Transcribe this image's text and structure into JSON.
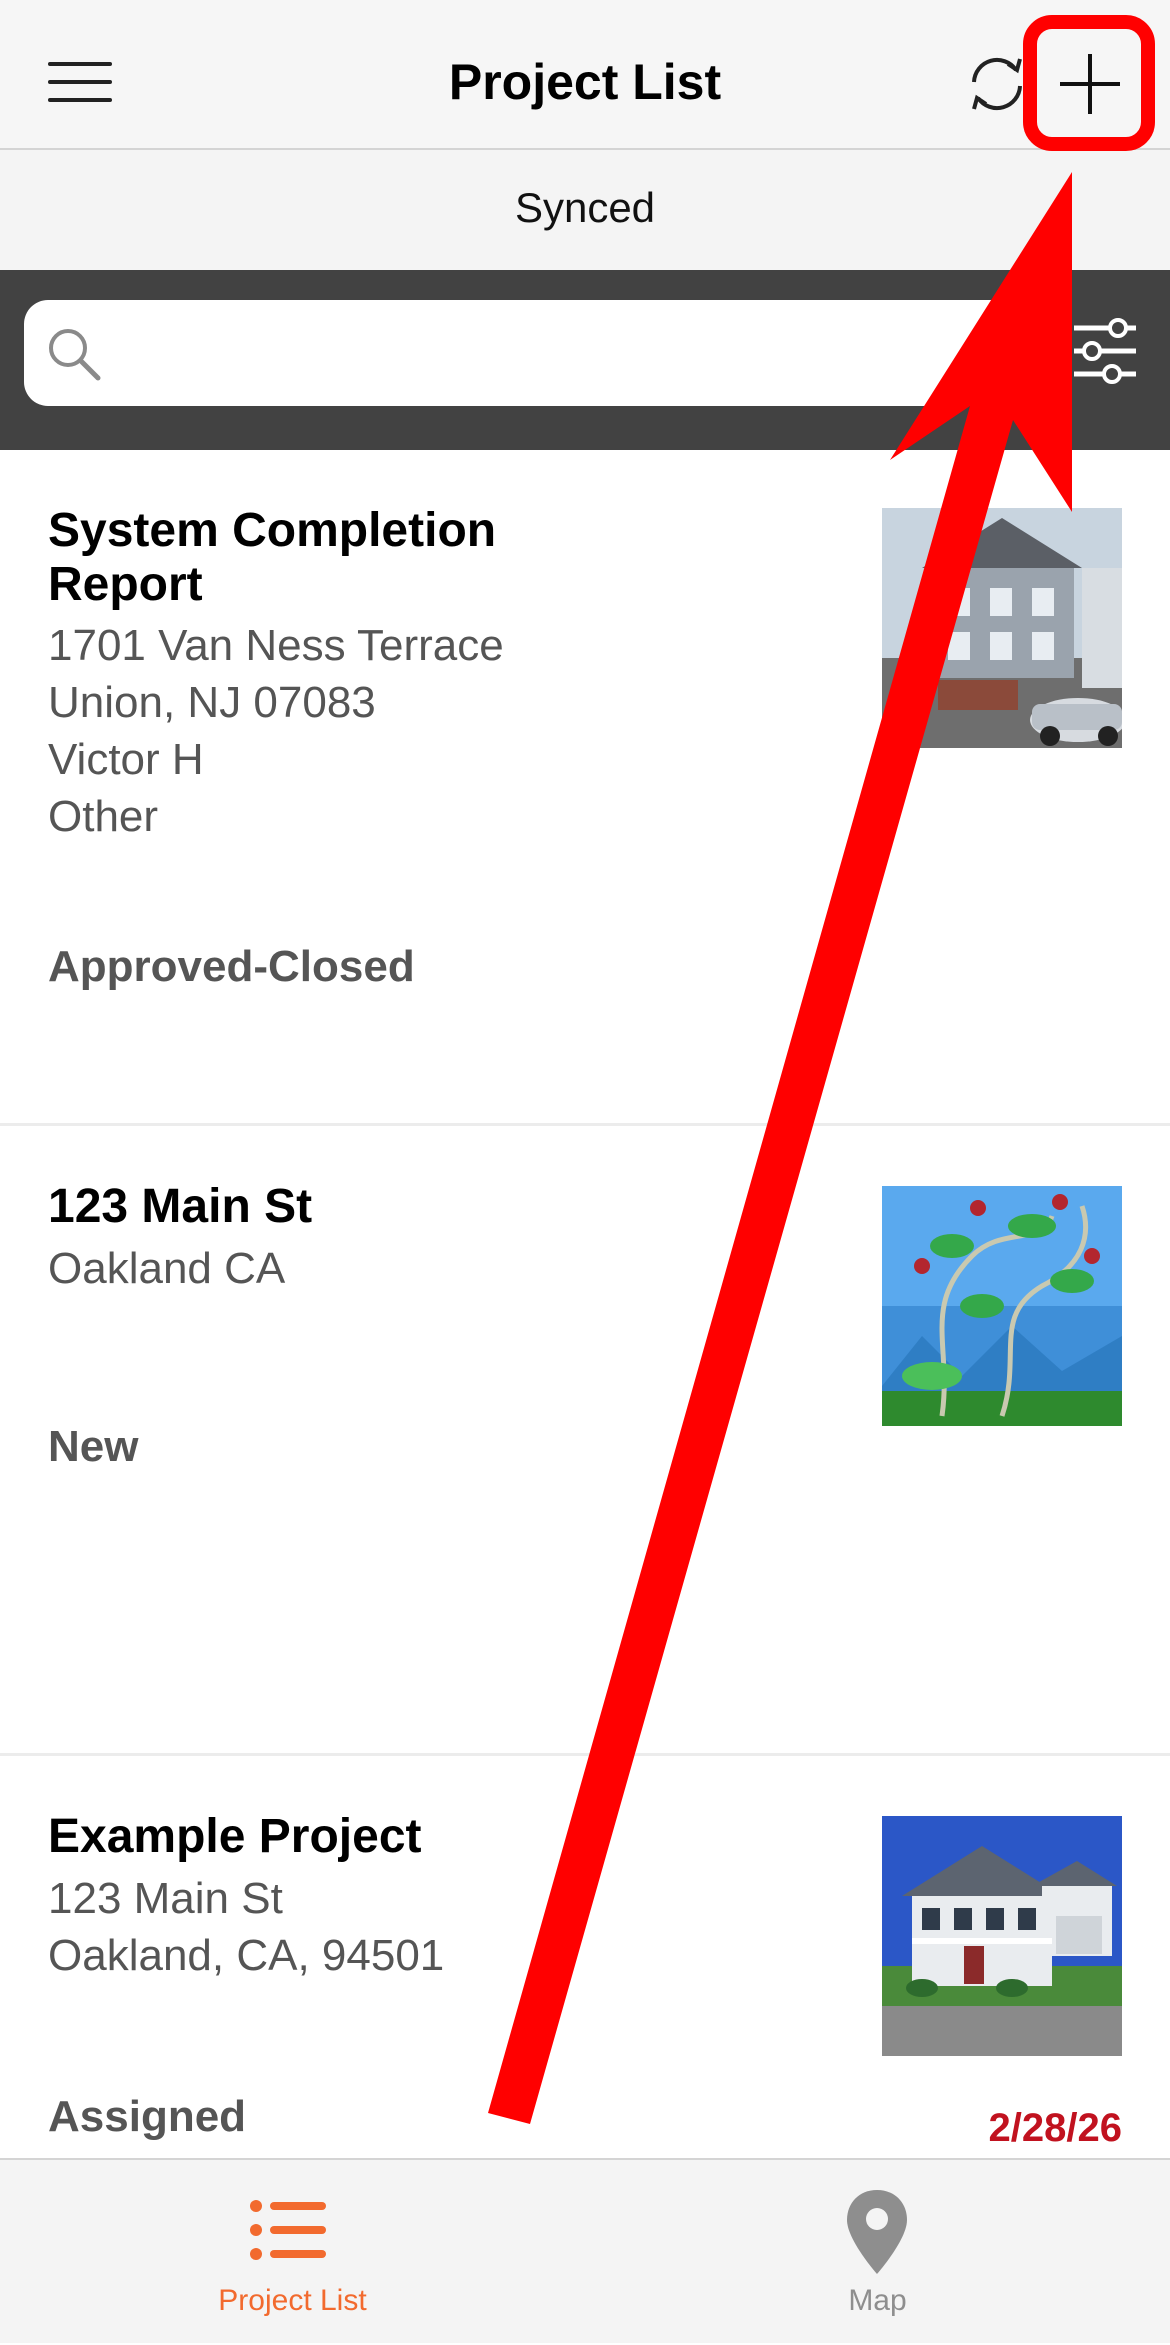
{
  "header": {
    "title": "Project List",
    "menu_icon": "hamburger-menu-icon",
    "sync_icon": "sync-arrows-icon",
    "add_icon": "plus-icon"
  },
  "sync": {
    "status": "Synced"
  },
  "search": {
    "value": "",
    "placeholder": "",
    "icon": "search-icon",
    "filter_icon": "sliders-icon"
  },
  "projects": [
    {
      "title": "System Completion Report",
      "lines": [
        "1701 Van Ness Terrace",
        "Union, NJ 07083",
        "Victor H",
        "Other"
      ],
      "status": "Approved-Closed",
      "date": "",
      "thumbnail": "house-photo"
    },
    {
      "title": "123 Main St",
      "lines": [
        "Oakland CA"
      ],
      "status": "New",
      "date": "",
      "thumbnail": "vines-artwork"
    },
    {
      "title": "Example Project",
      "lines": [
        "123 Main St",
        "Oakland, CA, 94501"
      ],
      "status": "Assigned",
      "date": "2/28/26",
      "thumbnail": "suburban-house-photo"
    }
  ],
  "tabs": [
    {
      "label": "Project List",
      "icon": "list-icon",
      "active": true
    },
    {
      "label": "Map",
      "icon": "map-pin-icon",
      "active": false
    }
  ],
  "colors": {
    "accent": "#f26a2e",
    "inactive": "#8e8e8e",
    "due_date": "#c1121f",
    "annotation": "#ff0000",
    "search_bar_bg": "#424242"
  }
}
